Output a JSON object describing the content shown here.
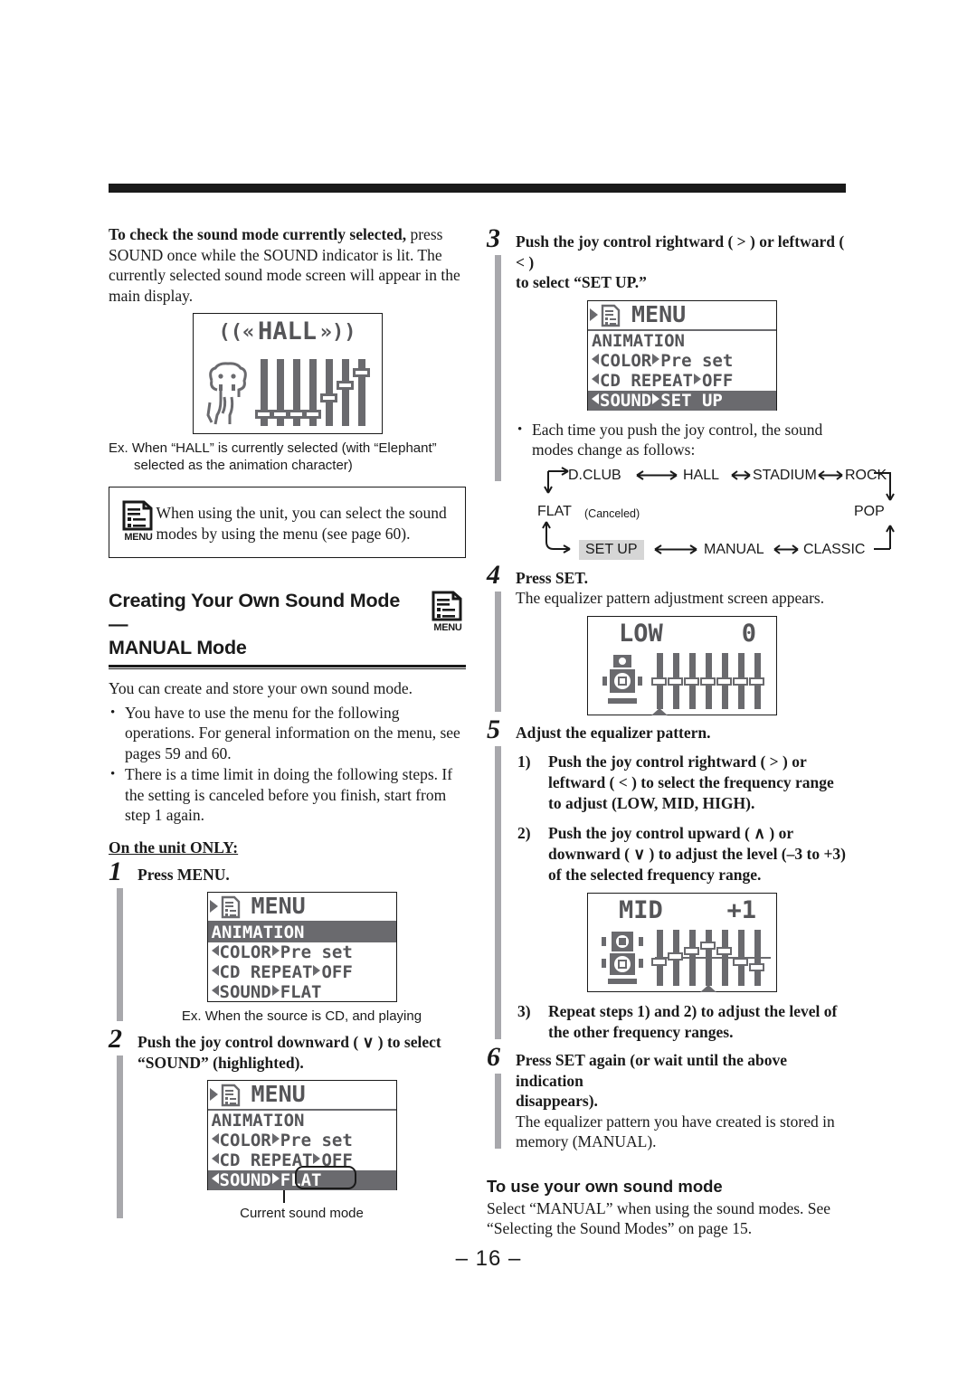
{
  "page": {
    "number_label": "– 16 –"
  },
  "left_column": {
    "intro": {
      "lead_bold": "To check the sound mode currently selected,",
      "lead_rest": " press SOUND once while the SOUND indicator is lit. The currently selected sound mode screen will appear in the main display."
    },
    "hall_display": {
      "mode_text": "HALL",
      "wave_left": "((«",
      "wave_right": "»))",
      "character": "elephant-character",
      "slider_levels": [
        -2,
        -2,
        -2,
        -2,
        0,
        1,
        2
      ]
    },
    "hall_caption": "Ex. When “HALL” is currently selected (with “Elephant” selected as the animation character)",
    "note_box": {
      "icon": "menu-icon",
      "icon_label": "MENU",
      "text": "When using the unit, you can select the sound modes by using the menu (see page 60)."
    },
    "section": {
      "heading_line1": "Creating Your Own Sound Mode —",
      "heading_line2": "MANUAL Mode",
      "icon_label": "MENU"
    },
    "section_intro": "You can create and store your own sound mode.",
    "section_bullets": [
      "You have to use the menu for the following operations. For general information on the menu, see pages 59 and 60.",
      "There is a time limit in doing the following steps. If the setting is canceled before you finish, start from step 1 again."
    ],
    "unit_only_heading": "On the unit ONLY:",
    "step1": {
      "number": "1",
      "title": "Press MENU.",
      "lcd": {
        "title": "MENU",
        "rows": [
          {
            "label": "ANIMATION",
            "value": "",
            "highlighted": true,
            "arrows": false
          },
          {
            "label": "COLOR",
            "value": "Pre set",
            "highlighted": false,
            "arrows": true
          },
          {
            "label": "CD REPEAT",
            "value": "OFF",
            "highlighted": false,
            "arrows": true
          },
          {
            "label": "SOUND",
            "value": "FLAT",
            "highlighted": false,
            "arrows": true
          }
        ]
      },
      "caption": "Ex. When the source is CD, and playing"
    },
    "step2": {
      "number": "2",
      "title_line1": "Push the joy control downward ( ∨ ) to select",
      "title_line2": "“SOUND” (highlighted).",
      "lcd": {
        "title": "MENU",
        "rows": [
          {
            "label": "ANIMATION",
            "value": "",
            "highlighted": false,
            "arrows": false
          },
          {
            "label": "COLOR",
            "value": "Pre set",
            "highlighted": false,
            "arrows": true
          },
          {
            "label": "CD REPEAT",
            "value": "OFF",
            "highlighted": false,
            "arrows": true
          },
          {
            "label": "SOUND",
            "value": "FLAT",
            "highlighted": true,
            "arrows": true
          }
        ]
      },
      "callout": "Current sound mode"
    }
  },
  "right_column": {
    "step3": {
      "number": "3",
      "title_line1": "Push the joy control rightward ( > ) or leftward ( < )",
      "title_line2": "to select “SET UP.”",
      "lcd": {
        "title": "MENU",
        "rows": [
          {
            "label": "ANIMATION",
            "value": "",
            "highlighted": false,
            "arrows": false
          },
          {
            "label": "COLOR",
            "value": "Pre set",
            "highlighted": false,
            "arrows": true
          },
          {
            "label": "CD REPEAT",
            "value": "OFF",
            "highlighted": false,
            "arrows": true
          },
          {
            "label": "SOUND",
            "value": "SET UP",
            "highlighted": true,
            "arrows": true
          }
        ]
      },
      "note": "Each time you push the joy control, the sound modes change as follows:"
    },
    "flow_diagram": {
      "row_top": [
        "D.CLUB",
        "HALL",
        "STADIUM",
        "ROCK"
      ],
      "row_left": "FLAT",
      "row_left_note": "(Canceled)",
      "row_right": "POP",
      "row_bottom": [
        "SET UP",
        "MANUAL",
        "CLASSIC"
      ],
      "highlighted": "SET UP"
    },
    "step4": {
      "number": "4",
      "title": "Press SET.",
      "body": "The equalizer pattern adjustment screen appears.",
      "lcd": {
        "band": "LOW",
        "level": "0",
        "slider_levels": [
          0,
          0,
          0,
          0,
          0,
          0,
          0
        ],
        "cursor_index": 0
      }
    },
    "step5": {
      "number": "5",
      "title": "Adjust the equalizer pattern.",
      "items": [
        {
          "n": "1)",
          "text": "Push the joy control rightward ( > ) or leftward ( < ) to select the frequency range to adjust (LOW, MID, HIGH)."
        },
        {
          "n": "2)",
          "text": "Push the joy control upward ( ∧ ) or downward ( ∨ ) to adjust the level (–3 to +3) of the selected frequency range."
        },
        {
          "n": "3)",
          "text": "Repeat steps 1) and 2) to adjust the level of the other frequency ranges."
        }
      ],
      "lcd": {
        "band": "MID",
        "level": "+1",
        "slider_levels": [
          -1,
          0,
          1,
          2,
          1,
          -1,
          -2
        ],
        "cursor_index": 3
      }
    },
    "step6": {
      "number": "6",
      "title_line1": "Press SET again (or wait until the above indication",
      "title_line2": "disappears).",
      "body": "The equalizer pattern you have created is stored in memory (MANUAL)."
    },
    "final_section": {
      "heading": "To use your own sound mode",
      "body": "Select “MANUAL” when using the sound modes. See “Selecting the Sound Modes” on page 15."
    }
  }
}
